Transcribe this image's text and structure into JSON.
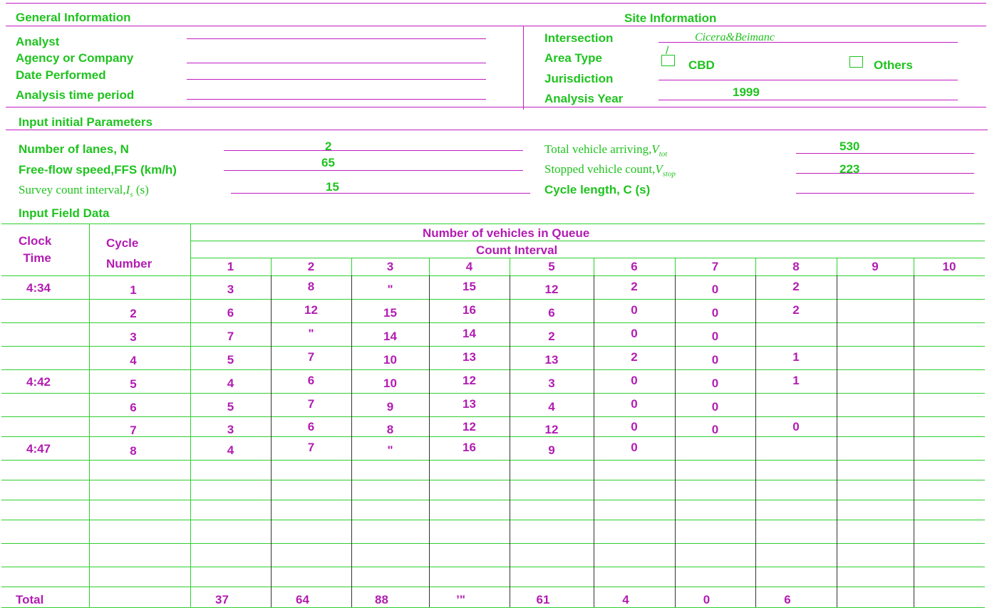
{
  "general": {
    "header": "General Information",
    "fields": [
      "Analyst",
      "Agency or Company",
      "Date Performed",
      "Analysis time period"
    ]
  },
  "site": {
    "header": "Site Information",
    "intersection_label": "Intersection",
    "intersection_value": "Cicera&Beimanc",
    "area_type_label": "Area Type",
    "cbd_label": "CBD",
    "others_label": "Others",
    "jurisdiction_label": "Jurisdiction",
    "analysis_year_label": "Analysis Year",
    "analysis_year_value": "1999"
  },
  "params": {
    "header": "Input initial Parameters",
    "lanes_label": "Number of lanes, N",
    "lanes_value": "2",
    "ffs_label": "Free-flow speed,FFS (km/h)",
    "ffs_value": "65",
    "survey_label": "Survey count interval,",
    "survey_var": "I",
    "survey_sub": "s",
    "survey_unit": " (s)",
    "survey_value": "15",
    "vtot_label": "Total vehicle arriving,",
    "vtot_var": "V",
    "vtot_sub": "tot",
    "vtot_value": "530",
    "vstop_label": "Stopped vehicle count,",
    "vstop_var": "V",
    "vstop_sub": "stop",
    "vstop_value": "223",
    "cycle_label": "Cycle length, C (s)"
  },
  "field": {
    "header": "Input Field Data",
    "clock_header_1": "Clock",
    "clock_header_2": "Time",
    "cycle_header_1": "Cycle",
    "cycle_header_2": "Number",
    "queue_header": "Number of vehicles in Queue",
    "interval_header": "Count Interval",
    "intervals": [
      "1",
      "2",
      "3",
      "4",
      "5",
      "6",
      "7",
      "8",
      "9",
      "10"
    ],
    "rows": [
      {
        "time": "4:34",
        "cycle": "1",
        "vals": [
          "3",
          "8",
          "\"",
          "15",
          "12",
          "2",
          "0",
          "2",
          "",
          ""
        ]
      },
      {
        "time": "",
        "cycle": "2",
        "vals": [
          "6",
          "12",
          "15",
          "16",
          "6",
          "0",
          "0",
          "2",
          "",
          ""
        ]
      },
      {
        "time": "",
        "cycle": "3",
        "vals": [
          "7",
          "\"",
          "14",
          "14",
          "2",
          "0",
          "0",
          "",
          "",
          ""
        ]
      },
      {
        "time": "",
        "cycle": "4",
        "vals": [
          "5",
          "7",
          "10",
          "13",
          "13",
          "2",
          "0",
          "1",
          "",
          ""
        ]
      },
      {
        "time": "4:42",
        "cycle": "5",
        "vals": [
          "4",
          "6",
          "10",
          "12",
          "3",
          "0",
          "0",
          "1",
          "",
          ""
        ]
      },
      {
        "time": "",
        "cycle": "6",
        "vals": [
          "5",
          "7",
          "9",
          "13",
          "4",
          "0",
          "0",
          "",
          "",
          ""
        ]
      },
      {
        "time": "",
        "cycle": "7",
        "vals": [
          "3",
          "6",
          "8",
          "12",
          "12",
          "0",
          "0",
          "0",
          "",
          ""
        ]
      },
      {
        "time": "4:47",
        "cycle": "8",
        "vals": [
          "4",
          "7",
          "\"",
          "16",
          "9",
          "0",
          "",
          "",
          "",
          ""
        ]
      }
    ],
    "total_label": "Total",
    "totals": [
      "37",
      "64",
      "88",
      "’\"",
      "61",
      "4",
      "0",
      "6",
      "",
      ""
    ]
  }
}
